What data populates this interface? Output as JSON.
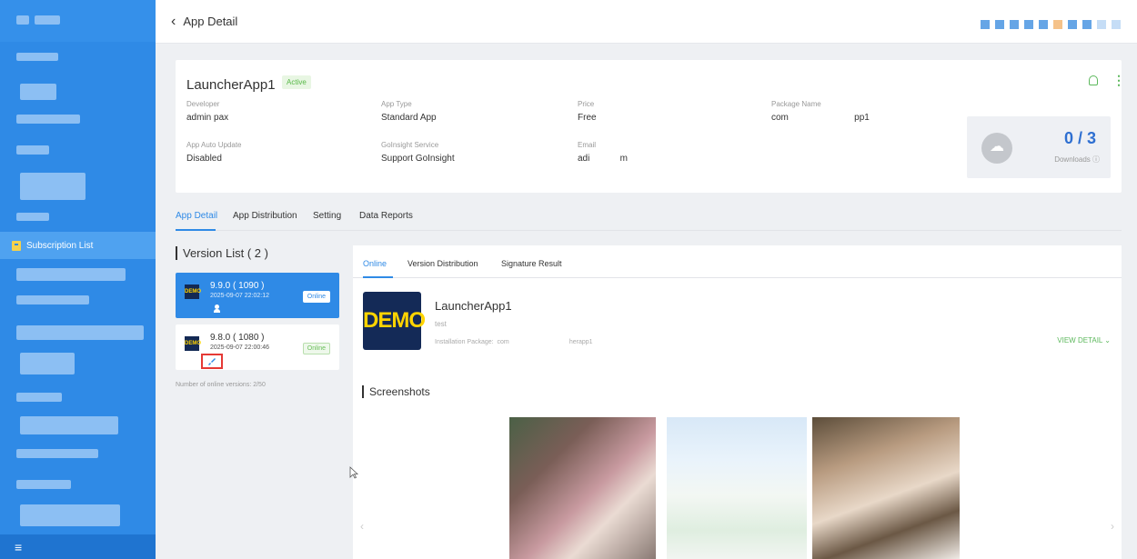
{
  "header": {
    "back_icon": "chevron-left-icon",
    "title": "App Detail"
  },
  "sidebar": {
    "active_item": "Subscription List",
    "bottom_icon": "menu-icon"
  },
  "app": {
    "name": "LauncherApp1",
    "status": "Active",
    "fields": {
      "developer_label": "Developer",
      "developer": "admin pax",
      "app_type_label": "App Type",
      "app_type": "Standard App",
      "price_label": "Price",
      "price": "Free",
      "package_label": "Package Name",
      "package": "com                          pp1",
      "auto_update_label": "App Auto Update",
      "auto_update": "Disabled",
      "goinsight_label": "GoInsight Service",
      "goinsight": "Support GoInsight",
      "email_label": "Email",
      "email": "adi            m"
    },
    "downloads": {
      "count": "0 / 3",
      "label": "Downloads ⓘ"
    }
  },
  "main_tabs": [
    "App Detail",
    "App Distribution",
    "Setting",
    "Data Reports"
  ],
  "version_list": {
    "title": "Version List ( 2 )",
    "items": [
      {
        "logo": "DEMO",
        "version": "9.9.0 ( 1090 )",
        "date": "2025-09-07 22:02:12",
        "status": "Online"
      },
      {
        "logo": "DEMO",
        "version": "9.8.0 ( 1080 )",
        "date": "2025-09-07 22:00:46",
        "status": "Online"
      }
    ],
    "note": "Number of online versions: 2/50"
  },
  "detail": {
    "sub_tabs": [
      "Online",
      "Version Distribution",
      "Signature Result"
    ],
    "logo": "DEMO",
    "name": "LauncherApp1",
    "description": "test",
    "package": "Installation Package:  com                                  herapp1",
    "view_detail": "VIEW DETAIL  ⌄",
    "screenshots_title": "Screenshots"
  },
  "colors": {
    "primary": "#2f8ae6",
    "success": "#5cb85c",
    "sidebar": "#2f8ae6"
  }
}
